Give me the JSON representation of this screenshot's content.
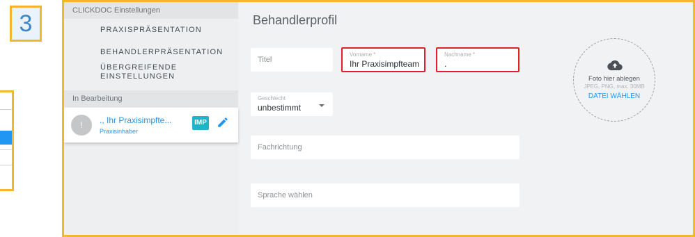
{
  "step": {
    "number": "3"
  },
  "sidebar": {
    "header": "CLICKDOC Einstellungen",
    "items": [
      {
        "label": "PRAXISPRÄSENTATION"
      },
      {
        "label": "BEHANDLERPRÄSENTATION"
      },
      {
        "label": "ÜBERGREIFENDE EINSTELLUNGEN"
      }
    ],
    "section": "In Bearbeitung",
    "profile": {
      "avatar_initial": "!",
      "name": "., Ihr Praxisimpfte...",
      "role": "Praxisinhaber",
      "badge": "IMP"
    }
  },
  "main": {
    "title": "Behandlerprofil",
    "titel": {
      "placeholder": "Titel"
    },
    "vorname": {
      "label": "Vorname *",
      "value": "Ihr Praxisimpfteam"
    },
    "nachname": {
      "label": "Nachname *",
      "value": "."
    },
    "geschlecht": {
      "label": "Geschlecht",
      "value": "unbestimmt"
    },
    "fachrichtung": {
      "placeholder": "Fachrichtung"
    },
    "sprache": {
      "placeholder": "Sprache wählen"
    },
    "photo": {
      "main": "Foto hier ablegen",
      "sub": "JPEG, PNG, max. 30MB",
      "button": "DATEI WÄHLEN"
    }
  },
  "colors": {
    "highlight": "#f5b72a",
    "accent": "#2196f3",
    "error": "#e0202a",
    "imp_badge": "#1fb5c6"
  },
  "icons": {
    "edit": "pencil-icon",
    "upload": "cloud-upload-icon",
    "dropdown": "caret-down-icon"
  }
}
